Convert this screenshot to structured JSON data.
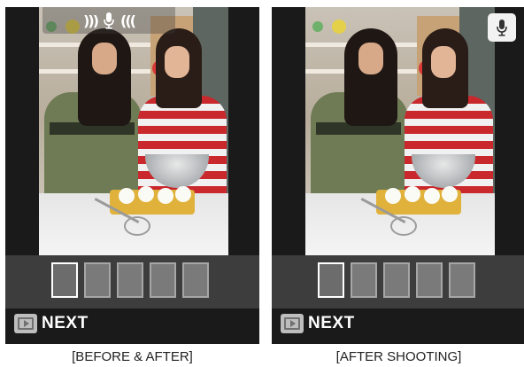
{
  "panels": {
    "before": {
      "caption": "[BEFORE & AFTER]",
      "next_label": "NEXT",
      "voice_indicator": {
        "left_wave": ")))",
        "right_wave": "(((",
        "icon": "microphone-icon"
      },
      "thumbnails": 5,
      "selected_thumbnail": 1
    },
    "after": {
      "caption": "[AFTER SHOOTING]",
      "next_label": "NEXT",
      "mic_badge_icon": "microphone-icon",
      "thumbnails": 5,
      "selected_thumbnail": 1
    }
  },
  "colors": {
    "panel_bg": "#1a1a1a",
    "thumb_bar_bg": "#3d3d3d",
    "thumb_border": "#a6a6a6",
    "selected_border": "#ffffff"
  }
}
